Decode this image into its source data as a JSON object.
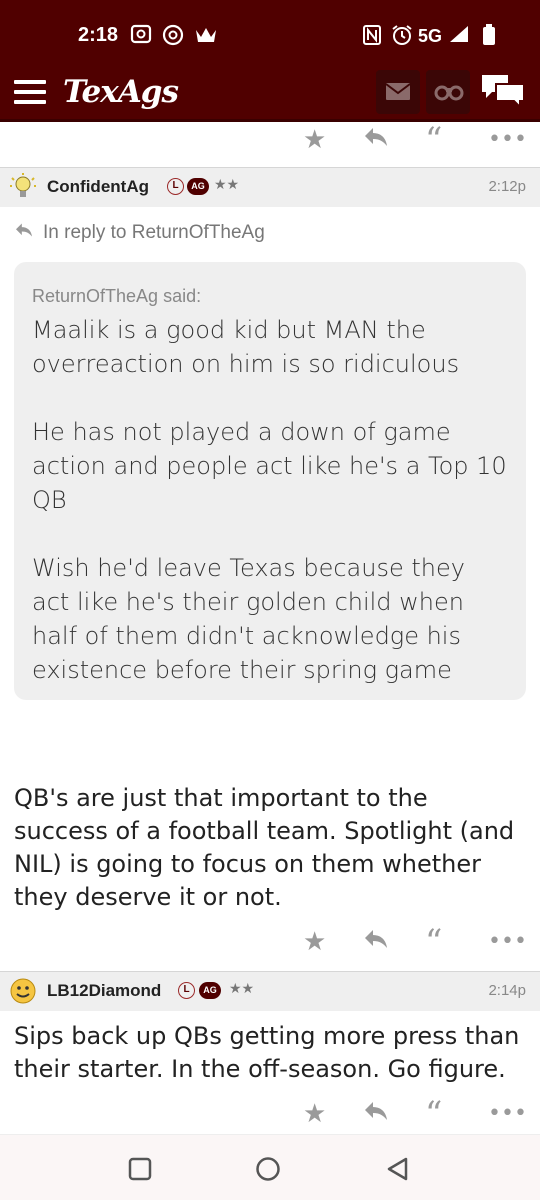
{
  "status": {
    "time": "2:18",
    "network": "5G"
  },
  "app": {
    "logo": "TexAgs"
  },
  "posts": [
    {
      "user": "ConfidentAg",
      "badge_l": "L",
      "badge_ag": "AG",
      "stars": "★★",
      "time": "2:12p",
      "reply_to": "In reply to ReturnOfTheAg",
      "quote_header": "ReturnOfTheAg said:",
      "quote_paragraphs": [
        "Maalik is a good kid but MAN the overreaction on him is so ridiculous",
        "He has not played a down of game action and people act like he's a Top 10 QB",
        "Wish he'd leave Texas because they act like he's their golden child when half of them didn't acknowledge his existence before their spring game"
      ],
      "body": "QB's are just that important to the success of a football team. Spotlight (and NIL) is going to focus on them whether they deserve it or not."
    },
    {
      "user": "LB12Diamond",
      "badge_l": "L",
      "badge_ag": "AG",
      "stars": "★★",
      "time": "2:14p",
      "body": "Sips back up QBs getting more press than their starter. In the off-season. Go figure."
    }
  ],
  "icons": {
    "star": "star-icon",
    "reply": "reply-icon",
    "quote": "quote-icon",
    "more": "more-icon",
    "mail": "mail-icon",
    "binoculars": "binoculars-icon",
    "chat": "chat-icon"
  },
  "colors": {
    "brand": "#500000",
    "header_bg": "#efefef",
    "quote_bg": "#efefef"
  }
}
